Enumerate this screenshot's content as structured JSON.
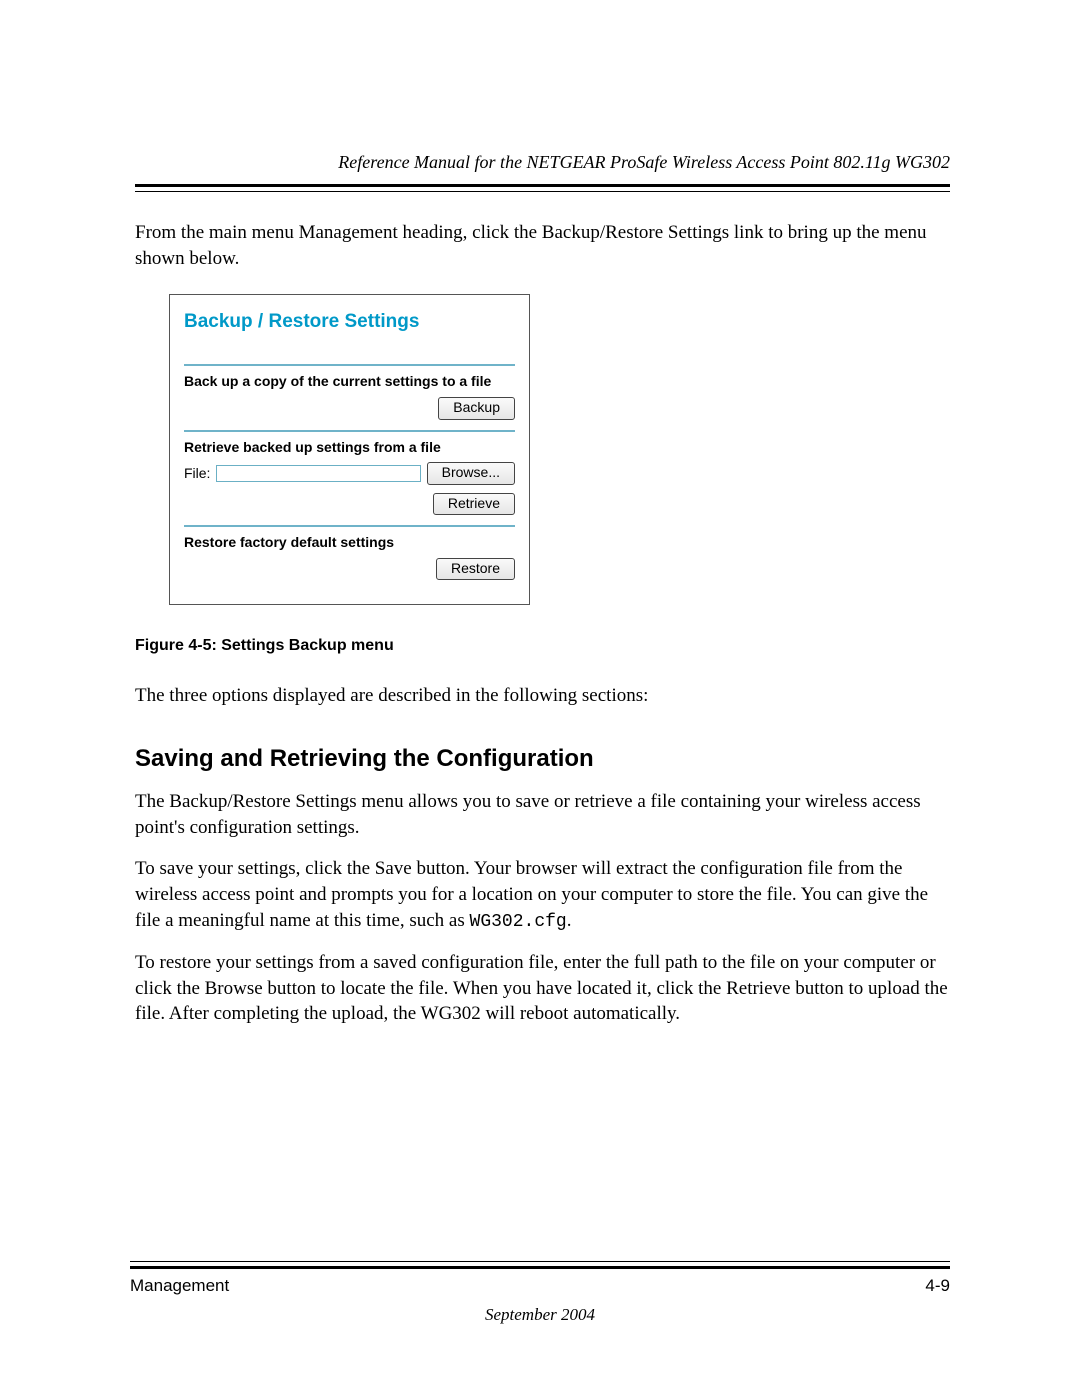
{
  "header": {
    "running_title": "Reference Manual for the NETGEAR ProSafe Wireless Access Point 802.11g WG302"
  },
  "intro_paragraph": "From the main menu Management heading, click the Backup/Restore Settings link to bring up the menu shown below.",
  "screenshot": {
    "title": "Backup / Restore Settings",
    "sections": {
      "backup": {
        "heading": "Back up a copy of the current settings to a file",
        "button": "Backup"
      },
      "retrieve": {
        "heading": "Retrieve backed up settings from a file",
        "file_label": "File:",
        "browse_button": "Browse...",
        "retrieve_button": "Retrieve"
      },
      "restore": {
        "heading": "Restore factory default settings",
        "button": "Restore"
      }
    }
  },
  "figure_caption": "Figure 4-5:  Settings Backup menu",
  "after_figure_paragraph": "The three options displayed are described in the following sections:",
  "section_heading": "Saving and Retrieving the Configuration",
  "para_1": "The Backup/Restore Settings menu allows you to save or retrieve a file containing your wireless access point's configuration settings.",
  "para_2_pre": "To save your settings, click the Save button. Your browser will extract the configuration file from the wireless access point and prompts you for a location on your computer to store the file. You can give the file a meaningful name at this time, such as ",
  "para_2_code": "WG302.cfg",
  "para_2_post": ".",
  "para_3": "To restore your settings from a saved configuration file, enter the full path to the file on your computer or click the Browse button to locate the file. When you have located it, click the Retrieve button to upload the file. After completing the upload, the WG302 will reboot automatically.",
  "footer": {
    "section": "Management",
    "page": "4-9",
    "date": "September 2004"
  }
}
